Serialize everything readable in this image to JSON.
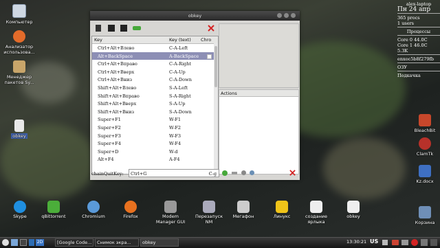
{
  "desktop": {
    "icons": [
      {
        "label": "Компьютер",
        "icon": "computer-icon"
      },
      {
        "label": "Анализатор использова...",
        "icon": "disk-analyzer-icon"
      },
      {
        "label": "Менеджер пакетов Sy...",
        "icon": "package-manager-icon"
      },
      {
        "label": "obkey",
        "icon": "file-icon"
      }
    ],
    "right_icons": [
      {
        "label": "BleachBit",
        "icon": "bleachbit-icon"
      },
      {
        "label": "ClamTk",
        "icon": "clamtk-icon"
      },
      {
        "label": "Kz.docx",
        "icon": "document-icon"
      },
      {
        "label": "Корзина",
        "icon": "trash-icon"
      }
    ]
  },
  "conky": {
    "hostname": "alex-laptop",
    "date_label": "Пн",
    "day": "24",
    "month": "апр",
    "procs": "365 procs",
    "users": "1 users",
    "processes_title": "Процессы",
    "core0": "Core 0   44.0C",
    "core1": "Core 1   46.0C",
    "net": "5.3K",
    "iface": "enxoc5b8f279fb",
    "ram_title": "ОЗУ",
    "swap_title": "Подкачка"
  },
  "window": {
    "title": "obkey",
    "columns": {
      "key": "Key",
      "key_text": "Key (text)",
      "chroot": "Chro"
    },
    "rows": [
      {
        "key": "Ctrl+Alt+Влево",
        "text": "C-A-Left"
      },
      {
        "key": "Alt+BackSpace",
        "text": "A-BackSpace"
      },
      {
        "key": "Ctrl+Alt+Вправо",
        "text": "C-A-Right"
      },
      {
        "key": "Ctrl+Alt+Вверх",
        "text": "C-A-Up"
      },
      {
        "key": "Ctrl+Alt+Вниз",
        "text": "C-A-Down"
      },
      {
        "key": "Shift+Alt+Влево",
        "text": "S-A-Left"
      },
      {
        "key": "Shift+Alt+Вправо",
        "text": "S-A-Right"
      },
      {
        "key": "Shift+Alt+Вверх",
        "text": "S-A-Up"
      },
      {
        "key": "Shift+Alt+Вниз",
        "text": "S-A-Down"
      },
      {
        "key": "Super+F1",
        "text": "W-F1"
      },
      {
        "key": "Super+F2",
        "text": "W-F2"
      },
      {
        "key": "Super+F3",
        "text": "W-F3"
      },
      {
        "key": "Super+F4",
        "text": "W-F4"
      },
      {
        "key": "Super+D",
        "text": "W-d"
      },
      {
        "key": "Alt+F4",
        "text": "A-F4"
      }
    ],
    "selected_row": 1,
    "actions_header": "Actions",
    "chain_quit_label": "chainQuitKey:",
    "chain_quit_value": "Ctrl+G",
    "chain_quit_text": "C-g"
  },
  "dock": [
    {
      "label": "Skype",
      "icon": "skype-icon"
    },
    {
      "label": "qBittorrent",
      "icon": "qbittorrent-icon"
    },
    {
      "label": "Chromium",
      "icon": "chromium-icon"
    },
    {
      "label": "Firefox",
      "icon": "firefox-icon"
    },
    {
      "label": "Modem Manager GUI",
      "icon": "modem-icon"
    },
    {
      "label": "Перезапуск NM",
      "icon": "network-restart-icon"
    },
    {
      "label": "Мегафон",
      "icon": "wifi-icon"
    },
    {
      "label": "Линукс",
      "icon": "linux-icon"
    },
    {
      "label": "создание ярлыка",
      "icon": "shortcut-file-icon"
    },
    {
      "label": "obkey",
      "icon": "file-icon"
    }
  ],
  "taskbar": {
    "badge": "2D",
    "tasks": [
      "[Google Code...",
      "Снимок экра...",
      "obkey"
    ],
    "time": "13:30:21",
    "layout": "US"
  },
  "colors": {
    "selection": "#8d8fb5",
    "accent_red": "#d42424",
    "accent_green": "#46a83a"
  }
}
